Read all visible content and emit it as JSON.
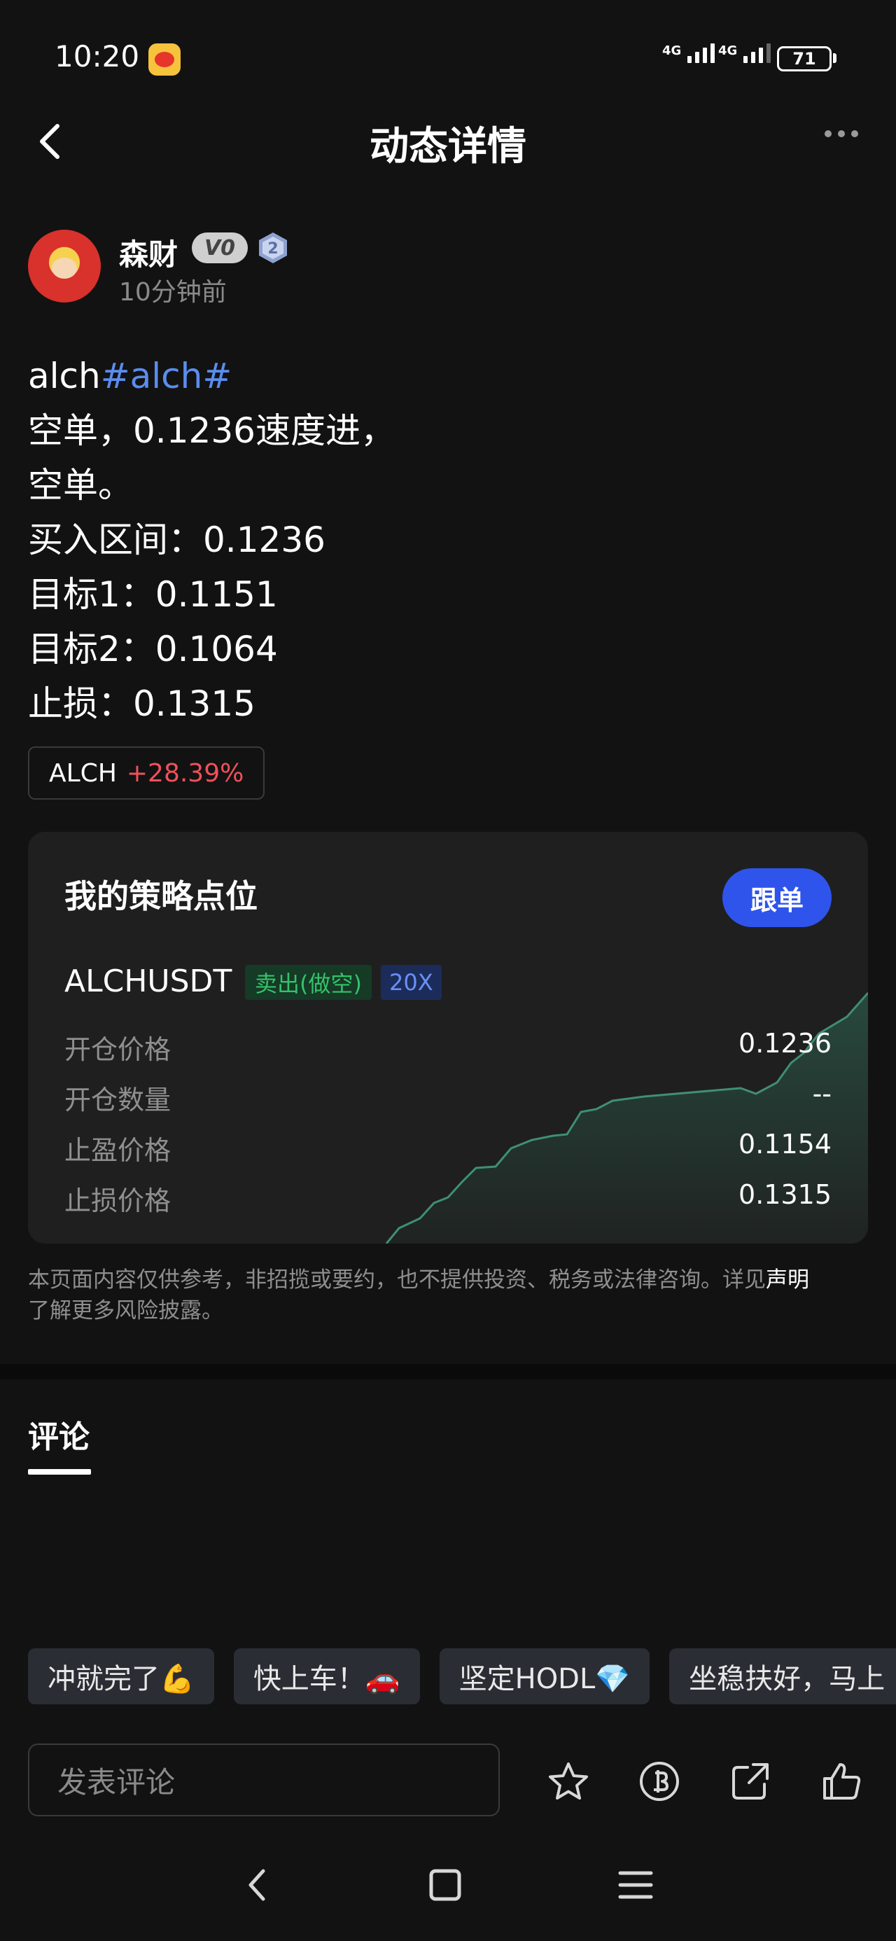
{
  "status_bar": {
    "time": "10:20",
    "battery": "71",
    "network_1": "4G",
    "network_2": "4G"
  },
  "header": {
    "title": "动态详情"
  },
  "author": {
    "name": "森财",
    "vip": "V0",
    "level": "2",
    "time": "10分钟前"
  },
  "post": {
    "prefix": "alch",
    "hashtag": "#alch#",
    "lines": [
      "空单，0.1236速度进，",
      "空单。",
      "买入区间：0.1236",
      "目标1：0.1151",
      "目标2：0.1064",
      "止损：0.1315"
    ]
  },
  "coin_tag": {
    "symbol": "ALCH",
    "change": "+28.39%"
  },
  "strategy": {
    "title": "我的策略点位",
    "follow_label": "跟单",
    "symbol": "ALCHUSDT",
    "side": "卖出(做空)",
    "leverage": "20X",
    "rows": [
      {
        "label": "开仓价格",
        "value": "0.1236"
      },
      {
        "label": "开仓数量",
        "value": "--"
      },
      {
        "label": "止盈价格",
        "value": "0.1154"
      },
      {
        "label": "止损价格",
        "value": "0.1315"
      }
    ]
  },
  "disclaimer": {
    "text": "本页面内容仅供参考，非招揽或要约，也不提供投资、税务或法律咨询。详见",
    "link": "声明",
    "suffix": "了解更多风险披露。"
  },
  "comments": {
    "tab_label": "评论",
    "quick_replies": [
      "冲就完了💪",
      "快上车！🚗",
      "坚定HODL💎",
      "坐稳扶好，马上"
    ],
    "input_placeholder": "发表评论"
  },
  "colors": {
    "accent": "#2f54eb",
    "up": "#f0515b",
    "short": "#35c16b",
    "hashtag": "#5a8dee"
  }
}
